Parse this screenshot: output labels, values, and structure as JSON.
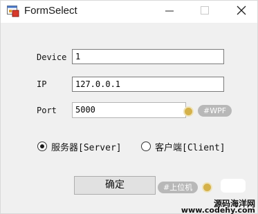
{
  "window": {
    "title": "FormSelect",
    "app_icon": "form-app-icon",
    "controls": [
      "minimize-icon",
      "maximize-icon",
      "close-icon"
    ]
  },
  "form": {
    "fields": [
      {
        "label": "Device",
        "value": "1"
      },
      {
        "label": "IP",
        "value": "127.0.0.1"
      },
      {
        "label": "Port",
        "value": "5000"
      }
    ],
    "mode": {
      "options": [
        {
          "label": "服务器[Server]",
          "selected": true
        },
        {
          "label": "客户端[Client]",
          "selected": false
        }
      ]
    },
    "ok_label": "确定"
  },
  "overlays": {
    "tag_wpf": "#WPF",
    "tag_upper": "#上位机"
  },
  "watermark": {
    "line1": "源码海洋网",
    "line2": "www.codehy.com"
  },
  "colors": {
    "window_bg": "#f0f0f0",
    "titlebar_bg": "#ffffff",
    "tag_bg": "#b8b8b8",
    "dot_color": "#d4b14a"
  }
}
